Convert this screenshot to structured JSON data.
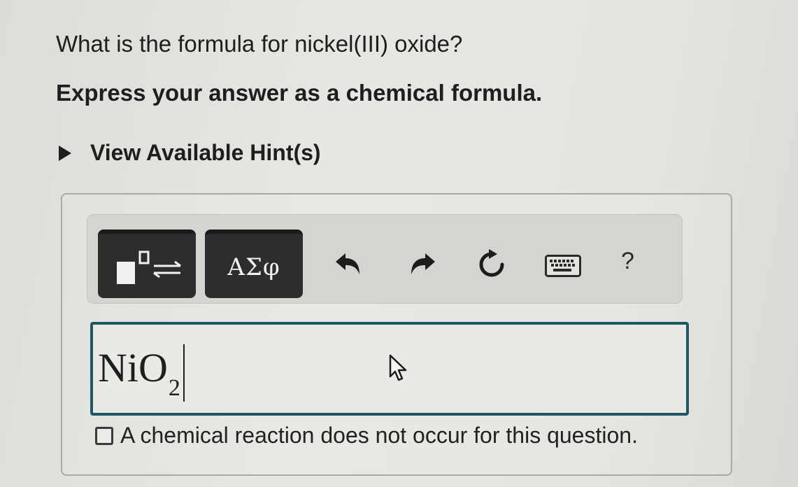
{
  "question": {
    "text": "What is the formula for nickel(III) oxide?"
  },
  "instruction": {
    "text": "Express your answer as a chemical formula."
  },
  "hint": {
    "label": "View Available Hint(s)",
    "icon": "triangle-right-icon"
  },
  "toolbar": {
    "templates_icon": "templates-icon",
    "greek_label": "ΑΣφ",
    "undo_icon": "undo-icon",
    "redo_icon": "redo-icon",
    "reset_icon": "reset-icon",
    "keyboard_icon": "keyboard-icon",
    "help_label": "?"
  },
  "answer": {
    "formula_main": "NiO",
    "formula_subscript": "2"
  },
  "no_reaction": {
    "checked": false,
    "label": "A chemical reaction does not occur for this question."
  },
  "colors": {
    "input_border": "#1e5866",
    "dark_button": "#2d2d2f",
    "background": "#e3e4e0"
  }
}
